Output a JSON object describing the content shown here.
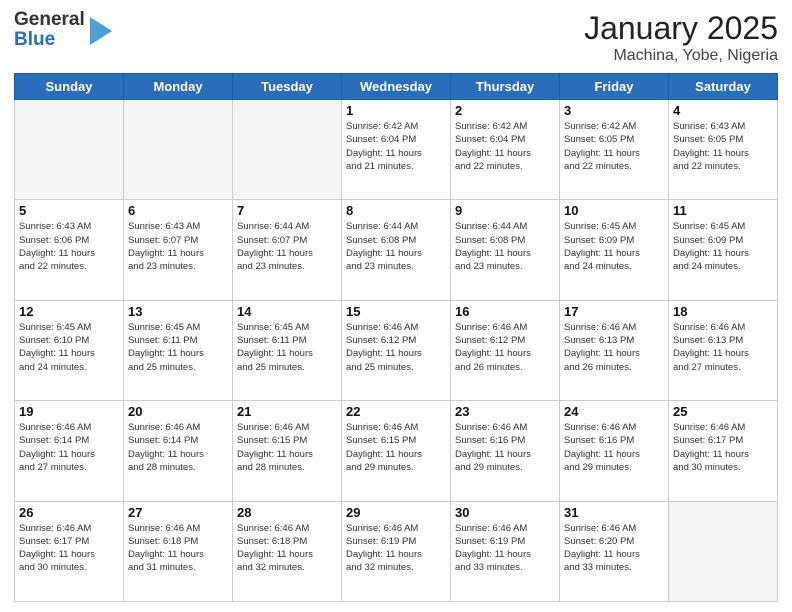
{
  "header": {
    "logo_line1": "General",
    "logo_line2": "Blue",
    "title": "January 2025",
    "subtitle": "Machina, Yobe, Nigeria"
  },
  "weekdays": [
    "Sunday",
    "Monday",
    "Tuesday",
    "Wednesday",
    "Thursday",
    "Friday",
    "Saturday"
  ],
  "weeks": [
    [
      {
        "day": "",
        "info": ""
      },
      {
        "day": "",
        "info": ""
      },
      {
        "day": "",
        "info": ""
      },
      {
        "day": "1",
        "info": "Sunrise: 6:42 AM\nSunset: 6:04 PM\nDaylight: 11 hours\nand 21 minutes."
      },
      {
        "day": "2",
        "info": "Sunrise: 6:42 AM\nSunset: 6:04 PM\nDaylight: 11 hours\nand 22 minutes."
      },
      {
        "day": "3",
        "info": "Sunrise: 6:42 AM\nSunset: 6:05 PM\nDaylight: 11 hours\nand 22 minutes."
      },
      {
        "day": "4",
        "info": "Sunrise: 6:43 AM\nSunset: 6:05 PM\nDaylight: 11 hours\nand 22 minutes."
      }
    ],
    [
      {
        "day": "5",
        "info": "Sunrise: 6:43 AM\nSunset: 6:06 PM\nDaylight: 11 hours\nand 22 minutes."
      },
      {
        "day": "6",
        "info": "Sunrise: 6:43 AM\nSunset: 6:07 PM\nDaylight: 11 hours\nand 23 minutes."
      },
      {
        "day": "7",
        "info": "Sunrise: 6:44 AM\nSunset: 6:07 PM\nDaylight: 11 hours\nand 23 minutes."
      },
      {
        "day": "8",
        "info": "Sunrise: 6:44 AM\nSunset: 6:08 PM\nDaylight: 11 hours\nand 23 minutes."
      },
      {
        "day": "9",
        "info": "Sunrise: 6:44 AM\nSunset: 6:08 PM\nDaylight: 11 hours\nand 23 minutes."
      },
      {
        "day": "10",
        "info": "Sunrise: 6:45 AM\nSunset: 6:09 PM\nDaylight: 11 hours\nand 24 minutes."
      },
      {
        "day": "11",
        "info": "Sunrise: 6:45 AM\nSunset: 6:09 PM\nDaylight: 11 hours\nand 24 minutes."
      }
    ],
    [
      {
        "day": "12",
        "info": "Sunrise: 6:45 AM\nSunset: 6:10 PM\nDaylight: 11 hours\nand 24 minutes."
      },
      {
        "day": "13",
        "info": "Sunrise: 6:45 AM\nSunset: 6:11 PM\nDaylight: 11 hours\nand 25 minutes."
      },
      {
        "day": "14",
        "info": "Sunrise: 6:45 AM\nSunset: 6:11 PM\nDaylight: 11 hours\nand 25 minutes."
      },
      {
        "day": "15",
        "info": "Sunrise: 6:46 AM\nSunset: 6:12 PM\nDaylight: 11 hours\nand 25 minutes."
      },
      {
        "day": "16",
        "info": "Sunrise: 6:46 AM\nSunset: 6:12 PM\nDaylight: 11 hours\nand 26 minutes."
      },
      {
        "day": "17",
        "info": "Sunrise: 6:46 AM\nSunset: 6:13 PM\nDaylight: 11 hours\nand 26 minutes."
      },
      {
        "day": "18",
        "info": "Sunrise: 6:46 AM\nSunset: 6:13 PM\nDaylight: 11 hours\nand 27 minutes."
      }
    ],
    [
      {
        "day": "19",
        "info": "Sunrise: 6:46 AM\nSunset: 6:14 PM\nDaylight: 11 hours\nand 27 minutes."
      },
      {
        "day": "20",
        "info": "Sunrise: 6:46 AM\nSunset: 6:14 PM\nDaylight: 11 hours\nand 28 minutes."
      },
      {
        "day": "21",
        "info": "Sunrise: 6:46 AM\nSunset: 6:15 PM\nDaylight: 11 hours\nand 28 minutes."
      },
      {
        "day": "22",
        "info": "Sunrise: 6:46 AM\nSunset: 6:15 PM\nDaylight: 11 hours\nand 29 minutes."
      },
      {
        "day": "23",
        "info": "Sunrise: 6:46 AM\nSunset: 6:16 PM\nDaylight: 11 hours\nand 29 minutes."
      },
      {
        "day": "24",
        "info": "Sunrise: 6:46 AM\nSunset: 6:16 PM\nDaylight: 11 hours\nand 29 minutes."
      },
      {
        "day": "25",
        "info": "Sunrise: 6:46 AM\nSunset: 6:17 PM\nDaylight: 11 hours\nand 30 minutes."
      }
    ],
    [
      {
        "day": "26",
        "info": "Sunrise: 6:46 AM\nSunset: 6:17 PM\nDaylight: 11 hours\nand 30 minutes."
      },
      {
        "day": "27",
        "info": "Sunrise: 6:46 AM\nSunset: 6:18 PM\nDaylight: 11 hours\nand 31 minutes."
      },
      {
        "day": "28",
        "info": "Sunrise: 6:46 AM\nSunset: 6:18 PM\nDaylight: 11 hours\nand 32 minutes."
      },
      {
        "day": "29",
        "info": "Sunrise: 6:46 AM\nSunset: 6:19 PM\nDaylight: 11 hours\nand 32 minutes."
      },
      {
        "day": "30",
        "info": "Sunrise: 6:46 AM\nSunset: 6:19 PM\nDaylight: 11 hours\nand 33 minutes."
      },
      {
        "day": "31",
        "info": "Sunrise: 6:46 AM\nSunset: 6:20 PM\nDaylight: 11 hours\nand 33 minutes."
      },
      {
        "day": "",
        "info": ""
      }
    ]
  ]
}
